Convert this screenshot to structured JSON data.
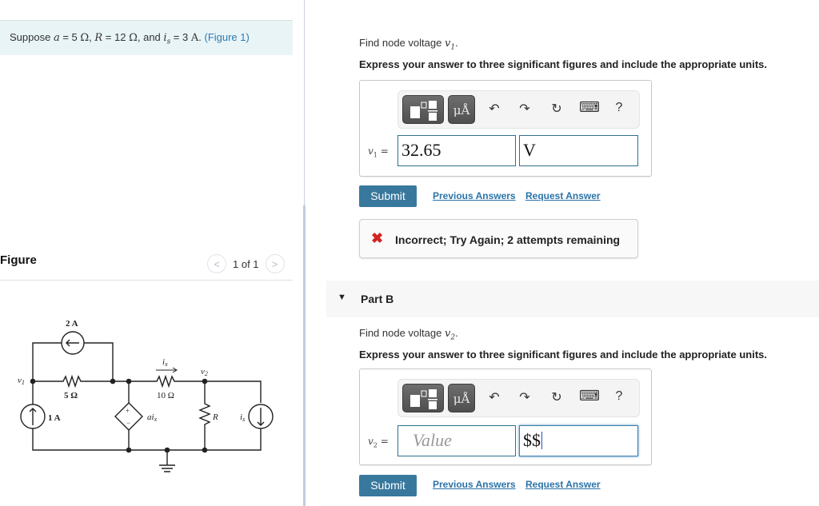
{
  "intro": {
    "prefix": "Suppose ",
    "a_sym": "a",
    "a_val": " = 5 ",
    "ohm1": "Ω",
    "sep1": ", ",
    "R_sym": "R",
    "R_val": " = 12 ",
    "ohm2": "Ω",
    "sep2": ", and ",
    "is_sym": "i",
    "is_sub": "s",
    "is_val": " = 3 ",
    "amp": "A",
    "suffix": ". ",
    "figure_link": "(Figure 1)"
  },
  "figure": {
    "title": "Figure",
    "page_label": "1 of 1",
    "prev_icon": "chevron-left",
    "next_icon": "chevron-right",
    "circuit_labels": {
      "top_source": "2 A",
      "v1": "v",
      "v1_sub": "1",
      "r1": "5 Ω",
      "left_source": "1 A",
      "dep_source": "ai",
      "dep_source_sub": "x",
      "ix": "i",
      "ix_sub": "x",
      "r2": "10 Ω",
      "v2": "v",
      "v2_sub": "2",
      "R": "R",
      "is": "i",
      "is_sub": "s"
    }
  },
  "partA": {
    "prompt_prefix": "Find node voltage ",
    "prompt_var": "v",
    "prompt_sub": "1",
    "prompt_suffix": ".",
    "instruction": "Express your answer to three significant figures and include the appropriate units.",
    "toolbar": {
      "templates_icon": "templates-icon",
      "units_label": "μÅ",
      "undo": "↶",
      "redo": "↷",
      "reset": "↻",
      "keyboard": "⌨",
      "help": "?"
    },
    "label_var": "v",
    "label_sub": "1",
    "label_eq": " =",
    "value": "32.65",
    "unit": "V",
    "submit": "Submit",
    "previous_answers": "Previous Answers",
    "request_answer": "Request Answer",
    "feedback": {
      "icon": "✖",
      "message": "Incorrect; Try Again; 2 attempts remaining",
      "color": "#d32424"
    }
  },
  "partB": {
    "header": "Part B",
    "toggle_icon": "▼",
    "prompt_prefix": "Find node voltage ",
    "prompt_var": "v",
    "prompt_sub": "2",
    "prompt_suffix": ".",
    "instruction": "Express your answer to three significant figures and include the appropriate units.",
    "toolbar": {
      "units_label": "μÅ",
      "undo": "↶",
      "redo": "↷",
      "reset": "↻",
      "keyboard": "⌨",
      "help": "?"
    },
    "label_var": "v",
    "label_sub": "2",
    "label_eq": " =",
    "value_placeholder": "Value",
    "unit_value": "$$",
    "submit": "Submit",
    "previous_answers": "Previous Answers",
    "request_answer": "Request Answer"
  },
  "colors": {
    "accent": "#39789d",
    "link": "#2a73a8",
    "intro_bg": "#e9f4f7",
    "error": "#d32424"
  }
}
